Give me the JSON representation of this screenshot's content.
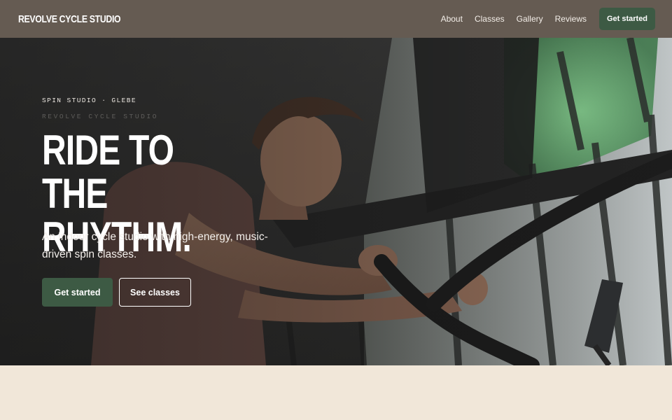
{
  "nav": {
    "brand": "REVOLVE CYCLE STUDIO",
    "links": [
      "About",
      "Classes",
      "Gallery",
      "Reviews"
    ],
    "cta": "Get started"
  },
  "hero": {
    "eyebrow": "SPIN STUDIO · GLEBE",
    "eyebrow_ghost": "REVOLVE CYCLE STUDIO",
    "headline": "RIDE TO THE RHYTHM.",
    "subtext": "An indoor cycle studio with high-energy, music-driven spin classes.",
    "primary_button": "Get started",
    "secondary_button": "See classes",
    "image_subject": "man riding an indoor spin bike by large windows"
  },
  "colors": {
    "nav_bg": "#655b52",
    "accent_green": "#3d5a44",
    "page_bg": "#f1e7d9"
  }
}
